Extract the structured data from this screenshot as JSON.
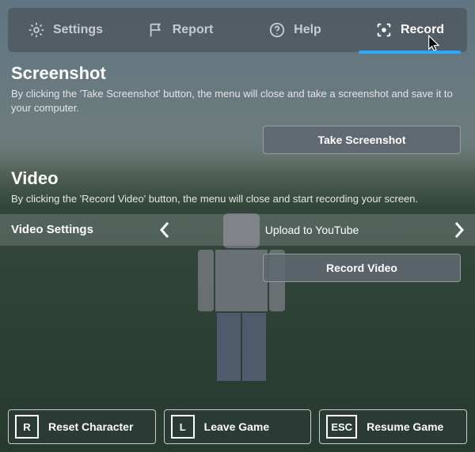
{
  "tabs": [
    {
      "id": "settings",
      "label": "Settings",
      "icon": "gear-icon"
    },
    {
      "id": "report",
      "label": "Report",
      "icon": "flag-icon"
    },
    {
      "id": "help",
      "label": "Help",
      "icon": "help-icon"
    },
    {
      "id": "record",
      "label": "Record",
      "icon": "record-icon",
      "active": true
    }
  ],
  "screenshot": {
    "title": "Screenshot",
    "desc": "By clicking the 'Take Screenshot' button, the menu will close and take a screenshot and save it to your computer.",
    "button": "Take Screenshot"
  },
  "video": {
    "title": "Video",
    "desc": "By clicking the 'Record Video' button, the menu will close and start recording your screen.",
    "settings_label": "Video Settings",
    "settings_value": "Upload to YouTube",
    "button": "Record Video"
  },
  "footer": {
    "reset": {
      "key": "R",
      "label": "Reset Character"
    },
    "leave": {
      "key": "L",
      "label": "Leave Game"
    },
    "resume": {
      "key": "ESC",
      "label": "Resume Game"
    }
  },
  "colors": {
    "accent": "#2aa9ff"
  }
}
